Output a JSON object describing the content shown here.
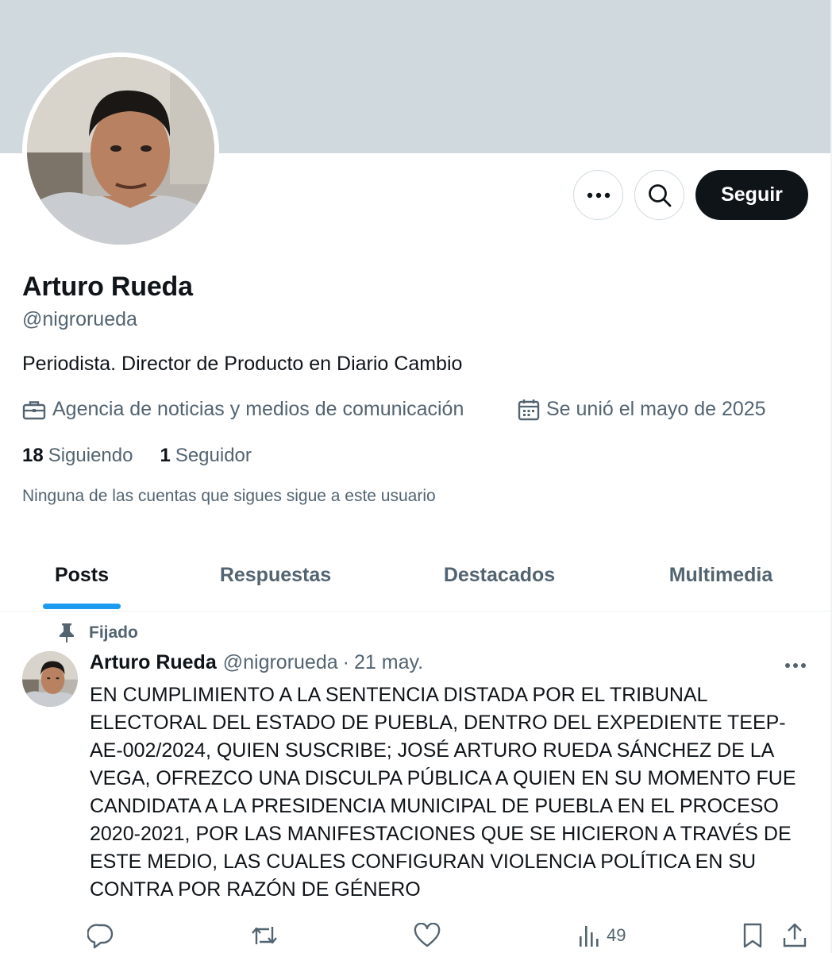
{
  "header": {
    "banner_color": "#cfd9de",
    "more_icon": "more-horizontal-icon",
    "search_icon": "search-icon",
    "follow_label": "Seguir"
  },
  "profile": {
    "name": "Arturo Rueda",
    "handle": "@nigrorueda",
    "bio": "Periodista. Director de Producto en Diario Cambio",
    "category_icon": "briefcase-icon",
    "category": "Agencia de noticias y medios de comunicación",
    "joined_icon": "calendar-icon",
    "joined": "Se unió el mayo de 2025",
    "following_count": "18",
    "following_label": "Siguiendo",
    "followers_count": "1",
    "followers_label": "Seguidor",
    "mutuals_text": "Ninguna de las cuentas que sigues sigue a este usuario"
  },
  "tabs": [
    {
      "label": "Posts",
      "active": true
    },
    {
      "label": "Respuestas",
      "active": false
    },
    {
      "label": "Destacados",
      "active": false
    },
    {
      "label": "Multimedia",
      "active": false
    }
  ],
  "pinned_post": {
    "pinned_label": "Fijado",
    "author_name": "Arturo Rueda",
    "author_handle": "@nigrorueda",
    "separator": "·",
    "date": "21 may.",
    "text_lines": [
      "EN CUMPLIMIENTO A LA SENTENCIA DISTADA POR EL TRIBUNAL",
      "ELECTORAL DEL ESTADO DE PUEBLA, DENTRO DEL EXPEDIENTE TEEP-",
      "AE-002/2024, QUIEN SUSCRIBE; JOSÉ ARTURO RUEDA SÁNCHEZ DE LA",
      "VEGA, OFREZCO UNA DISCULPA PÚBLICA A QUIEN EN SU MOMENTO FUE",
      "CANDIDATA A LA PRESIDENCIA MUNICIPAL DE PUEBLA EN EL PROCESO",
      "2020-2021, POR LAS MANIFESTACIONES QUE SE HICIERON A TRAVÉS DE",
      "ESTE MEDIO, LAS CUALES CONFIGURAN VIOLENCIA POLÍTICA EN SU",
      "CONTRA POR RAZÓN DE GÉNERO"
    ],
    "actions": {
      "reply_icon": "reply-icon",
      "repost_icon": "repost-icon",
      "like_icon": "like-icon",
      "views_icon": "views-icon",
      "views_count": "49",
      "bookmark_icon": "bookmark-icon",
      "share_icon": "share-icon"
    }
  },
  "colors": {
    "text_primary": "#0f1419",
    "text_secondary": "#536471",
    "accent": "#1d9bf0",
    "border": "#cfd9de"
  }
}
